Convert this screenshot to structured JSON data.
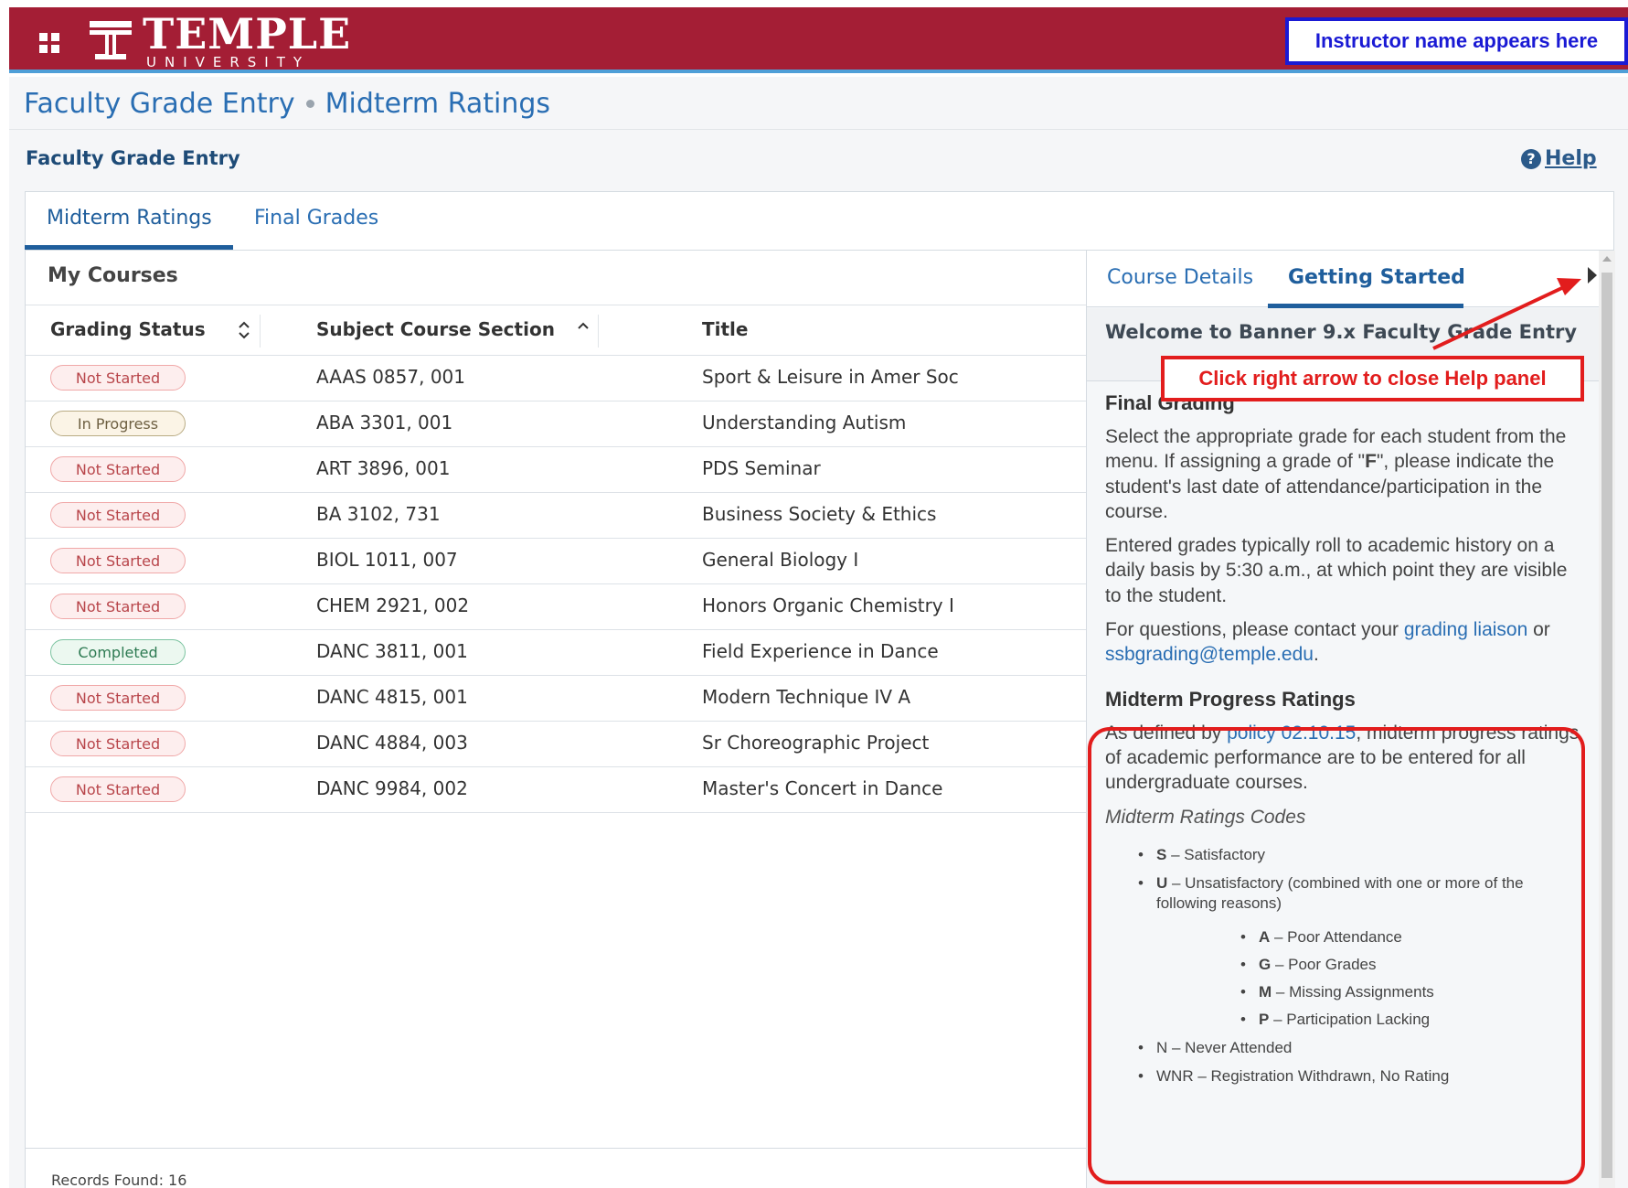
{
  "header": {
    "logo_name": "TEMPLE",
    "logo_sub": "UNIVERSITY",
    "instructor_label": "Instructor name appears here",
    "brand_color": "#a41e35",
    "accent_color": "#4f9fd8"
  },
  "breadcrumb": {
    "item1": "Faculty Grade Entry",
    "item2": "Midterm Ratings"
  },
  "page": {
    "title": "Faculty Grade Entry",
    "help_label": "Help"
  },
  "tabs": {
    "midterm": "Midterm Ratings",
    "final": "Final Grades"
  },
  "courses": {
    "heading": "My Courses",
    "columns": {
      "status": "Grading Status",
      "course": "Subject Course Section",
      "title": "Title"
    },
    "rows": [
      {
        "status": "Not Started",
        "course": "AAAS 0857, 001",
        "title": "Sport & Leisure in Amer Soc"
      },
      {
        "status": "In Progress",
        "course": "ABA 3301, 001",
        "title": "Understanding Autism"
      },
      {
        "status": "Not Started",
        "course": "ART 3896, 001",
        "title": "PDS Seminar"
      },
      {
        "status": "Not Started",
        "course": "BA 3102, 731",
        "title": "Business Society & Ethics"
      },
      {
        "status": "Not Started",
        "course": "BIOL 1011, 007",
        "title": "General Biology I"
      },
      {
        "status": "Not Started",
        "course": "CHEM 2921, 002",
        "title": "Honors Organic Chemistry I"
      },
      {
        "status": "Completed",
        "course": "DANC 3811, 001",
        "title": "Field Experience in Dance"
      },
      {
        "status": "Not Started",
        "course": "DANC 4815, 001",
        "title": "Modern Technique IV A"
      },
      {
        "status": "Not Started",
        "course": "DANC 4884, 003",
        "title": "Sr Choreographic Project"
      },
      {
        "status": "Not Started",
        "course": "DANC 9984, 002",
        "title": "Master's Concert in Dance"
      }
    ],
    "records": "Records Found: 16"
  },
  "help_panel": {
    "tab_course": "Course Details",
    "tab_getting": "Getting Started",
    "welcome": "Welcome to Banner 9.x Faculty Grade Entry",
    "final_heading": "Final Grading",
    "final_p1a": "Select the appropriate grade for each student from the menu. If assigning a grade of \"",
    "final_p1_grade": "F",
    "final_p1b": "\", please indicate the student's last date of attendance/participation in the course.",
    "final_p2": "Entered grades typically roll to academic history on a daily basis by 5:30 a.m., at which point they are visible to the student.",
    "final_p3_a": "For questions, please contact your ",
    "final_p3_link1": "grading liaison",
    "final_p3_b": " or ",
    "final_p3_link2": "ssbgrading@temple.edu",
    "final_p3_c": ".",
    "midterm_heading": "Midterm Progress Ratings",
    "midterm_p_a": "As defined by ",
    "midterm_p_link": "policy 02.10.15",
    "midterm_p_b": ", midterm progress ratings of academic performance are to be entered for all undergraduate courses.",
    "codes_heading": "Midterm Ratings Codes",
    "code_s_key": "S",
    "code_s_text": " – Satisfactory",
    "code_u_key": "U",
    "code_u_text": " – Unsatisfactory (combined with one or more of the following reasons)",
    "sub_a_key": "A",
    "sub_a_text": " – Poor Attendance",
    "sub_g_key": "G",
    "sub_g_text": " – Poor Grades",
    "sub_m_key": "M",
    "sub_m_text": " – Missing Assignments",
    "sub_p_key": "P",
    "sub_p_text": " – Participation Lacking",
    "code_n": "N – Never Attended",
    "code_wnr": "WNR – Registration Withdrawn, No Rating"
  },
  "annotation": {
    "label": "Click right arrow to close Help panel",
    "color": "#e21d1d"
  }
}
